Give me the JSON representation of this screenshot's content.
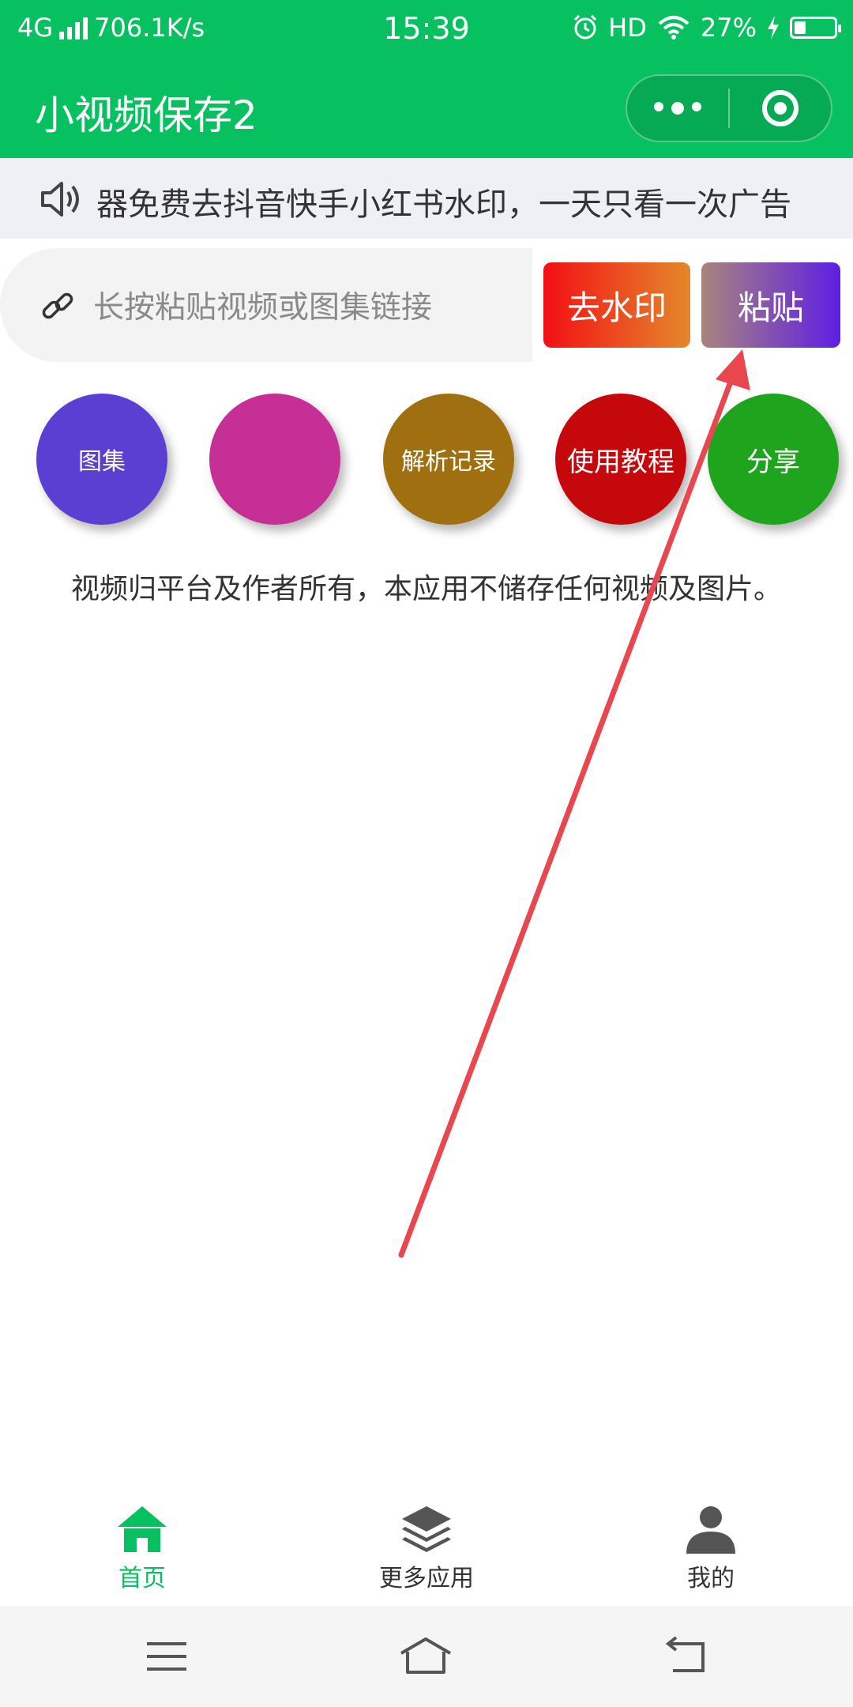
{
  "status_bar": {
    "network": "4G",
    "speed": "706.1K/s",
    "time": "15:39",
    "hd": "HD",
    "battery": "27%"
  },
  "nav": {
    "title": "小视频保存2"
  },
  "notice": {
    "text": "器免费去抖音快手小红书水印，一天只看一次广告"
  },
  "input": {
    "placeholder": "长按粘贴视频或图集链接"
  },
  "buttons": {
    "remove_watermark": "去水印",
    "paste": "粘贴"
  },
  "circles": {
    "gallery": "图集",
    "blank": "",
    "history": "解析记录",
    "tutorial": "使用教程",
    "share": "分享"
  },
  "disclaimer": "视频归平台及作者所有，本应用不储存任何视频及图片。",
  "tabs": [
    {
      "label": "首页",
      "icon": "home-icon",
      "active": true
    },
    {
      "label": "更多应用",
      "icon": "layers-icon",
      "active": false
    },
    {
      "label": "我的",
      "icon": "user-icon",
      "active": false
    }
  ],
  "colors": {
    "brand_green": "#07c160",
    "annotation_arrow": "#e8474f"
  }
}
